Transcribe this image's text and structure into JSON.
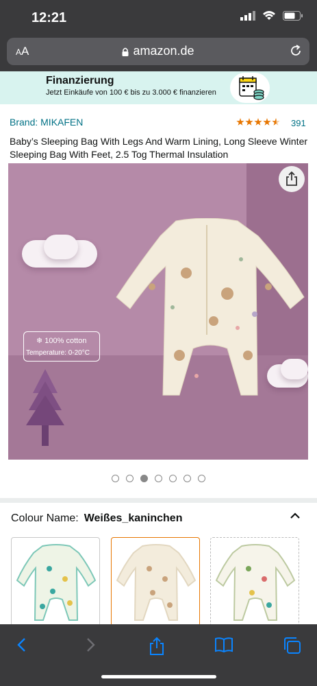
{
  "status_bar": {
    "time": "12:21"
  },
  "browser": {
    "font_size_label_small": "A",
    "font_size_label": "A",
    "url": "amazon.de"
  },
  "finance_banner": {
    "title": "Finanzierung",
    "subtitle": "Jetzt Einkäufe von 100 € bis zu 3.000 € finanzieren"
  },
  "product": {
    "brand": "Brand: MIKAFEN",
    "rating_stars": 4.5,
    "rating_count": "391",
    "title": "Baby’s Sleeping Bag With Legs And Warm Lining, Long Sleeve Winter Sleeping Bag With Feet, 2.5 Tog Thermal Insulation",
    "image_badge_line1": "100% cotton",
    "image_badge_line2": "Temperature: 0-20°C",
    "carousel_count": 7,
    "carousel_active_index": 2
  },
  "variation": {
    "label": "Colour Name:",
    "value": "Weißes_kaninchen"
  },
  "colors": {
    "accent": "#e77600",
    "link": "#007185",
    "chrome": "#3a3a3c",
    "ios_blue": "#0a84ff"
  }
}
